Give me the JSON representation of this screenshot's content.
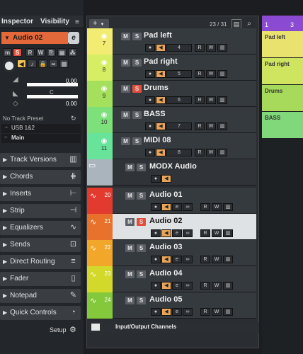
{
  "inspector": {
    "tabs": [
      "Inspector",
      "Visibility"
    ],
    "track_name": "Audio 02",
    "volume_value": "0.00",
    "pan_label": "C",
    "pan_value": "0.00",
    "preset": "No Track Preset",
    "input": "USB 1&2",
    "output": "Main",
    "sections": [
      "Track Versions",
      "Chords",
      "Inserts",
      "Strip",
      "Equalizers",
      "Sends",
      "Direct Routing",
      "Fader",
      "Notepad",
      "Quick Controls"
    ],
    "setup": "Setup"
  },
  "toolbar": {
    "add": "+",
    "count": "23 / 31"
  },
  "tracks": [
    {
      "num": "7",
      "name": "Pad left",
      "ch": "4",
      "color": "#f3ec72",
      "type": "midi"
    },
    {
      "num": "8",
      "name": "Pad right",
      "ch": "5",
      "color": "#d6ee64",
      "type": "midi"
    },
    {
      "num": "9",
      "name": "Drums",
      "ch": "6",
      "color": "#a4e05c",
      "type": "midi"
    },
    {
      "num": "10",
      "name": "BASS",
      "ch": "7",
      "color": "#7ee07a",
      "type": "midi"
    },
    {
      "num": "11",
      "name": "MIDI 08",
      "ch": "8",
      "color": "#67e39a",
      "type": "midi"
    }
  ],
  "folder": {
    "name": "MODX Audio"
  },
  "audio_tracks": [
    {
      "num": "20",
      "name": "Audio 01",
      "color": "#e23a2e"
    },
    {
      "num": "21",
      "name": "Audio 02",
      "color": "#e8722c"
    },
    {
      "num": "22",
      "name": "Audio 03",
      "color": "#f2a62a"
    },
    {
      "num": "23",
      "name": "Audio 04",
      "color": "#d3d92a"
    },
    {
      "num": "24",
      "name": "Audio 05",
      "color": "#84c83b"
    }
  ],
  "io": {
    "name": "Input/Output Channels"
  },
  "ruler": {
    "marks": [
      "1",
      "3"
    ]
  },
  "parts": [
    "Pad left",
    "Pad right",
    "Drums",
    "BASS"
  ]
}
